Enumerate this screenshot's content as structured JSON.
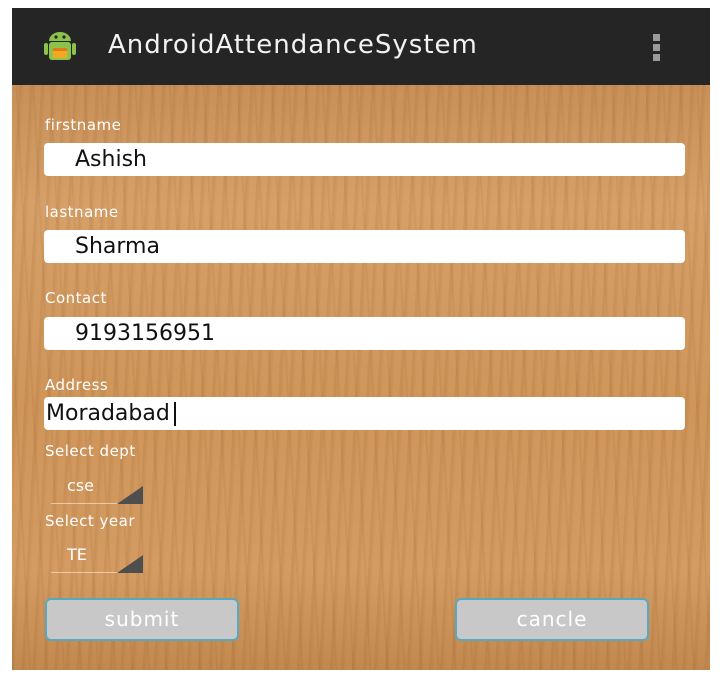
{
  "app": {
    "title": "AndroidAttendanceSystem",
    "icon": "android-robot-icon"
  },
  "actionbar": {
    "overflow_icon": "overflow-menu-icon"
  },
  "form": {
    "firstname": {
      "label": "firstname",
      "value": "Ashish"
    },
    "lastname": {
      "label": "lastname",
      "value": "Sharma"
    },
    "contact": {
      "label": "Contact",
      "value": "9193156951"
    },
    "address": {
      "label": "Address",
      "value": "Moradabad"
    },
    "dept": {
      "label": "Select dept",
      "selected": "cse"
    },
    "year": {
      "label": "Select year",
      "selected": "TE"
    }
  },
  "buttons": {
    "submit": "submit",
    "cancel": "cancle"
  },
  "colors": {
    "actionbar": "#252525",
    "button_border": "#5aa8c0",
    "button_bg": "#c8c8c8"
  }
}
